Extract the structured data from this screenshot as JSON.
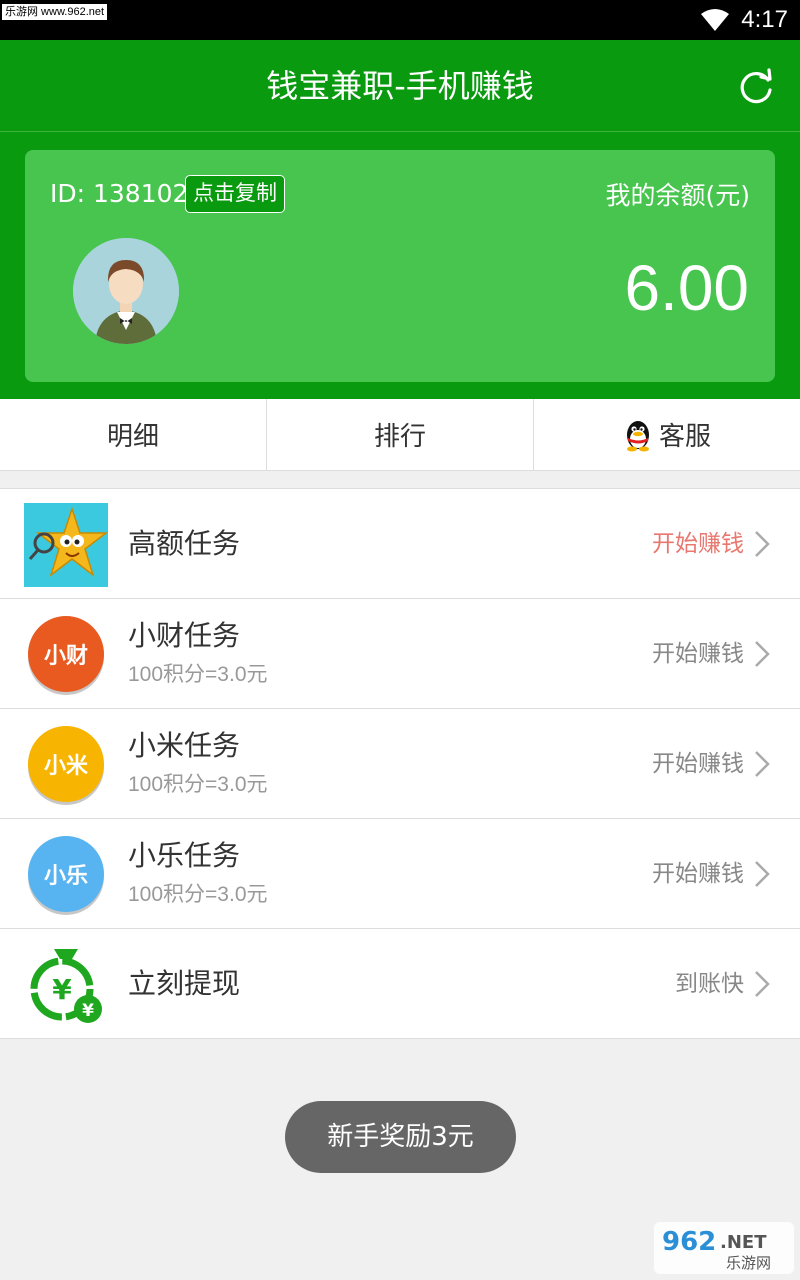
{
  "status_bar": {
    "watermark": "乐游网 www.962.net",
    "time": "4:17"
  },
  "app_bar": {
    "title": "钱宝兼职-手机赚钱",
    "refresh_icon": "refresh-icon"
  },
  "account": {
    "id_label": "ID: 138102",
    "copy_button": "点击复制",
    "balance_label": "我的余额(元)",
    "balance_value": "6.00"
  },
  "tabs": [
    {
      "label": "明细"
    },
    {
      "label": "排行"
    },
    {
      "label": "客服",
      "icon": "qq-penguin-icon"
    }
  ],
  "tasks": [
    {
      "title": "高额任务",
      "subtitle": "",
      "action": "开始赚钱",
      "action_color": "#e8776f",
      "icon": "star-mascot-icon"
    },
    {
      "title": "小财任务",
      "subtitle": "100积分=3.0元",
      "action": "开始赚钱",
      "icon_text": "小财",
      "icon_color": "#e85a1f"
    },
    {
      "title": "小米任务",
      "subtitle": "100积分=3.0元",
      "action": "开始赚钱",
      "icon_text": "小米",
      "icon_color": "#f7b400"
    },
    {
      "title": "小乐任务",
      "subtitle": "100积分=3.0元",
      "action": "开始赚钱",
      "icon_text": "小乐",
      "icon_color": "#58b4f0"
    },
    {
      "title": "立刻提现",
      "subtitle": "",
      "action": "到账快",
      "icon": "money-bag-icon"
    }
  ],
  "toast": "新手奖励3元",
  "colors": {
    "primary_green": "#0a9a10",
    "card_green": "#48c54f"
  }
}
